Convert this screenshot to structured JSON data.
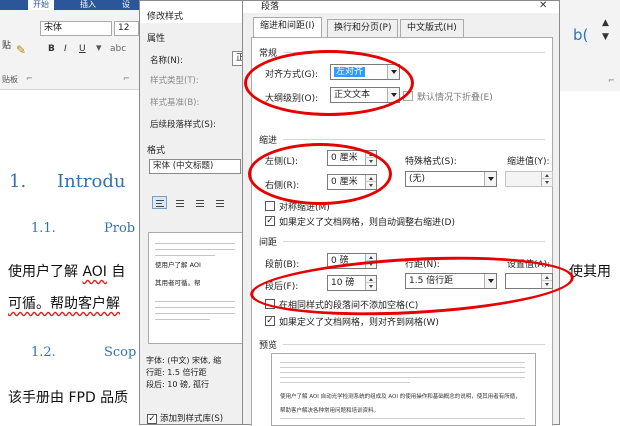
{
  "ribbon": {
    "tabs": [
      "开始",
      "插入",
      "设"
    ],
    "font_name": "宋体",
    "font_size": "12",
    "bold": "B",
    "italic": "I",
    "underline": "U",
    "paste_label": "贴",
    "clipboard_group": "贴板",
    "style_preview": "b(",
    "launcher": "⌐"
  },
  "document": {
    "heading1_number": "1.",
    "heading1_text": "Introdu",
    "heading2a_number": "1.1.",
    "heading2a_text": "Prob",
    "para1_line1_start": "使用户了解",
    "para1_line1_aoi": "AOI",
    "para1_line1_mid": "自",
    "para1_line1_end": "使其用",
    "para1_line2_start": "可循。帮助客户解",
    "heading2b_number": "1.2.",
    "heading2b_text": "Scop",
    "para2_start": "该手册由 FPD 品质"
  },
  "modify_dialog": {
    "title": "修改样式",
    "properties_group": "属性",
    "name_label": "名称(N):",
    "name_value": "正",
    "type_label": "样式类型(T):",
    "based_on_label": "样式基准(B):",
    "next_style_label": "后续段落样式(S):",
    "format_group": "格式",
    "font_value": "宋体 (中文标题)",
    "preview_text_line1": "使用户了解 AOI",
    "preview_text_line2": "其用者可循。帮",
    "desc_line1": "字体: (中文) 宋体, 缩",
    "desc_line2": "行距: 1.5 倍行距",
    "desc_line3": "段后: 10 磅, 孤行",
    "add_to_gallery": "添加到样式库(S)"
  },
  "paragraph_dialog": {
    "title": "段落",
    "tabs": [
      "缩进和间距(I)",
      "换行和分页(P)",
      "中文版式(H)"
    ],
    "general_section": "常规",
    "alignment_label": "对齐方式(G):",
    "alignment_value": "左对齐",
    "outline_label": "大纲级别(O):",
    "outline_value": "正文文本",
    "collapsed_default_label": "默认情况下折叠(E)",
    "indent_section": "缩进",
    "left_label": "左侧(L):",
    "left_value": "0 厘米",
    "right_label": "右侧(R):",
    "right_value": "0 厘米",
    "special_label": "特殊格式(S):",
    "special_value": "(无)",
    "indent_by_label": "缩进值(Y):",
    "mirror_indent_label": "对称缩进(M)",
    "auto_adjust_indent_label": "如果定义了文档网格，则自动调整右缩进(D)",
    "spacing_section": "间距",
    "before_label": "段前(B):",
    "before_value": "0 磅",
    "after_label": "段后(F):",
    "after_value": "10 磅",
    "line_spacing_label": "行距(N):",
    "line_spacing_value": "1.5 倍行距",
    "at_label": "设置值(A):",
    "no_space_same_style_label": "在相同样式的段落间不添加空格(C)",
    "snap_to_grid_label": "如果定义了文档网格，则对齐到网格(W)",
    "preview_section": "预览",
    "preview_line1": "使用户了解 AOI 自动光学检测系统的组成及 AOI 的使用操作和基础概念的说明，使其用者有所循，",
    "preview_line2": "帮助客户解决各种常用问题和培训资料。"
  },
  "checks": {
    "checked_mark": "✓"
  },
  "colors": {
    "ribbon_blue": "#2b579a",
    "heading_blue": "#2e74b5",
    "annotation_red": "#e60000",
    "selection_blue": "#3399ff"
  }
}
